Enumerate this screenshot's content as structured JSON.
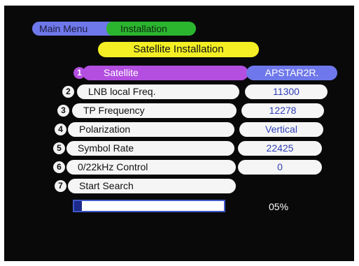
{
  "breadcrumb": {
    "main_menu": "Main Menu",
    "installation": "Installation"
  },
  "page_title": "Satellite Installation",
  "rows": [
    {
      "num": "1",
      "label": "Satellite",
      "value": "APSTAR2R."
    },
    {
      "num": "2",
      "label": "LNB local Freq.",
      "value": "11300"
    },
    {
      "num": "3",
      "label": "TP Frequency",
      "value": "12278"
    },
    {
      "num": "4",
      "label": "Polarization",
      "value": "Vertical"
    },
    {
      "num": "5",
      "label": "Symbol Rate",
      "value": "22425"
    },
    {
      "num": "6",
      "label": "0/22kHz Control",
      "value": "0"
    },
    {
      "num": "7",
      "label": "Start Search"
    }
  ],
  "progress": {
    "fraction": 0.05,
    "text": "05%"
  },
  "colors": {
    "tab_main": "#6f78ea",
    "tab_installation": "#2bb52f",
    "title_bar": "#f3ef24",
    "selected_label": "#b34ee0",
    "selected_value": "#6f78ea"
  }
}
